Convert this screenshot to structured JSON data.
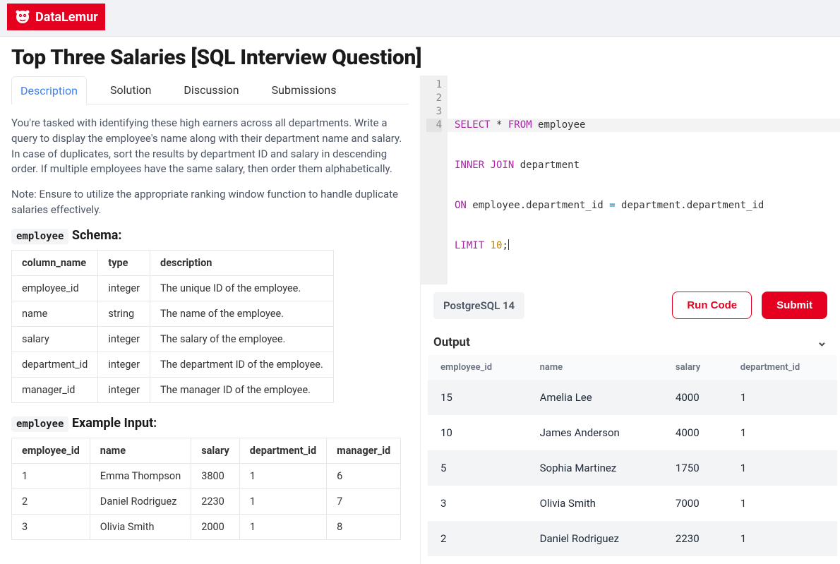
{
  "brand": "DataLemur",
  "title": "Top Three Salaries [SQL Interview Question]",
  "tabs": [
    "Description",
    "Solution",
    "Discussion",
    "Submissions"
  ],
  "desc": {
    "p1": "You're tasked with identifying these high earners across all departments. Write a query to display the employee's name along with their department name and salary. In case of duplicates, sort the results by department ID and salary in descending order. If multiple employees have the same salary, then order them alphabetically.",
    "p2": "Note: Ensure to utilize the appropriate ranking window function to handle duplicate salaries effectively."
  },
  "schema_label": "employee",
  "schema_suffix": " Schema:",
  "schema_cols": [
    "column_name",
    "type",
    "description"
  ],
  "schema_rows": [
    [
      "employee_id",
      "integer",
      "The unique ID of the employee."
    ],
    [
      "name",
      "string",
      "The name of the employee."
    ],
    [
      "salary",
      "integer",
      "The salary of the employee."
    ],
    [
      "department_id",
      "integer",
      "The department ID of the employee."
    ],
    [
      "manager_id",
      "integer",
      "The manager ID of the employee."
    ]
  ],
  "example_label": "employee",
  "example_suffix": " Example Input:",
  "example_cols": [
    "employee_id",
    "name",
    "salary",
    "department_id",
    "manager_id"
  ],
  "example_rows": [
    [
      "1",
      "Emma Thompson",
      "3800",
      "1",
      "6"
    ],
    [
      "2",
      "Daniel Rodriguez",
      "2230",
      "1",
      "7"
    ],
    [
      "3",
      "Olivia Smith",
      "2000",
      "1",
      "8"
    ]
  ],
  "code": {
    "l1": {
      "a": "SELECT",
      "b": " * ",
      "c": "FROM",
      "d": " employee"
    },
    "l2": {
      "a": "INNER JOIN",
      "b": " department"
    },
    "l3": {
      "a": "ON",
      "b": " employee.department_id ",
      "c": "=",
      "d": " department.department_id"
    },
    "l4": {
      "a": "LIMIT ",
      "b": "10",
      "c": ";"
    },
    "gut": [
      "1",
      "2",
      "3",
      "4"
    ]
  },
  "runbar": {
    "lang": "PostgreSQL 14",
    "run": "Run Code",
    "submit": "Submit"
  },
  "output": {
    "title": "Output",
    "cols": [
      "employee_id",
      "name",
      "salary",
      "department_id"
    ],
    "rows": [
      [
        "15",
        "Amelia Lee",
        "4000",
        "1"
      ],
      [
        "10",
        "James Anderson",
        "4000",
        "1"
      ],
      [
        "5",
        "Sophia Martinez",
        "1750",
        "1"
      ],
      [
        "3",
        "Olivia Smith",
        "7000",
        "1"
      ],
      [
        "2",
        "Daniel Rodriguez",
        "2230",
        "1"
      ]
    ]
  }
}
